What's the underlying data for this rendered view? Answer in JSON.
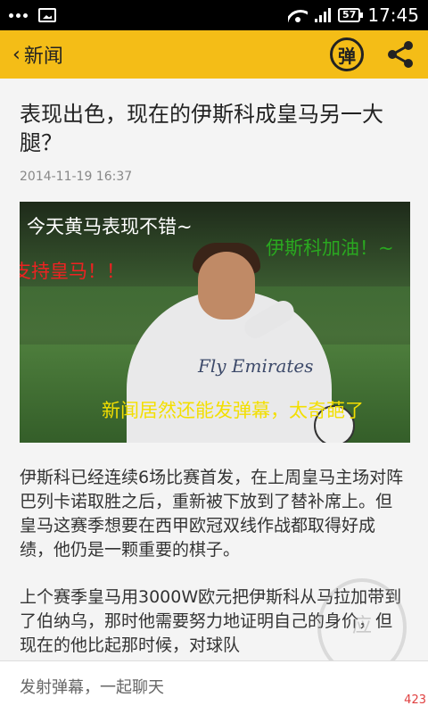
{
  "status_bar": {
    "time": "17:45",
    "battery": "57",
    "icons": [
      "dots-icon",
      "image-icon",
      "wifi-icon",
      "signal-icon",
      "battery-icon"
    ]
  },
  "header": {
    "back_label": "新闻",
    "danmu_label": "弹",
    "share_icon": "share-icon",
    "background_color": "#f4bd17"
  },
  "article": {
    "title": "表现出色，现在的伊斯科成皇马另一大腿？",
    "date": "2014-11-19 16:37",
    "photo": {
      "danmu": [
        "今天黄马表现不错~",
        "伊斯科加油！~",
        "支持皇马！！",
        "新闻居然还能发弹幕，太奇葩了"
      ],
      "shirt_text": "Fly Emirates"
    },
    "paragraphs": [
      "伊斯科已经连续6场比赛首发，在上周皇马主场对阵巴列卡诺取胜之后，重新被下放到了替补席上。但皇马这赛季想要在西甲欧冠双线作战都取得好成绩，他仍是一颗重要的棋子。",
      "上个赛季皇马用3000W欧元把伊斯科从马拉加带到了伯纳乌，那时他需要努力地证明自己的身价，但现在的他比起那时候，对球队"
    ]
  },
  "comment_bar": {
    "placeholder": "发射弹幕，一起聊天",
    "count": "423"
  }
}
